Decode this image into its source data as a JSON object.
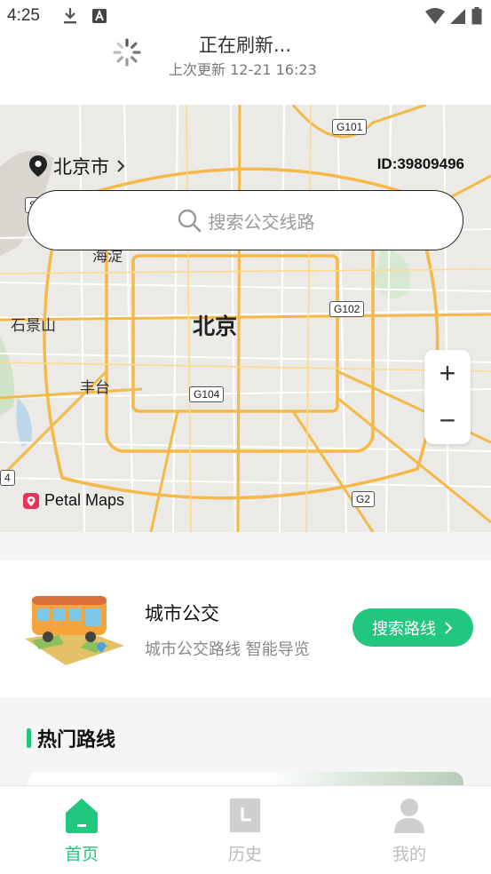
{
  "status_bar": {
    "time": "4:25",
    "icons": [
      "download-icon",
      "a-badge-icon",
      "wifi-icon",
      "signal-icon",
      "battery-icon"
    ]
  },
  "refresh": {
    "title": "正在刷新...",
    "last_update": "上次更新 12-21 16:23"
  },
  "map": {
    "city": "北京市",
    "id_text": "ID:39809496",
    "search_placeholder": "搜索公交线路",
    "labels": {
      "center": "北京",
      "shijingshan": "石景山",
      "fengtai": "丰台",
      "haidian": "海淀"
    },
    "roads": [
      "G101",
      "G102",
      "G104",
      "G2",
      "4",
      "S"
    ],
    "zoom_in": "+",
    "zoom_out": "−",
    "attribution": "Petal Maps"
  },
  "city_bus": {
    "title": "城市公交",
    "subtitle": "城市公交路线 智能导览",
    "button": "搜索路线"
  },
  "hot_routes": {
    "title": "热门路线"
  },
  "nav": {
    "items": [
      {
        "label": "首页",
        "icon": "home-icon",
        "active": true
      },
      {
        "label": "历史",
        "icon": "history-icon",
        "active": false
      },
      {
        "label": "我的",
        "icon": "profile-icon",
        "active": false
      }
    ]
  },
  "colors": {
    "accent": "#22c77e",
    "inactive": "#cfcfcf",
    "map_bg": "#eceae6",
    "road_major": "#f5b947"
  }
}
